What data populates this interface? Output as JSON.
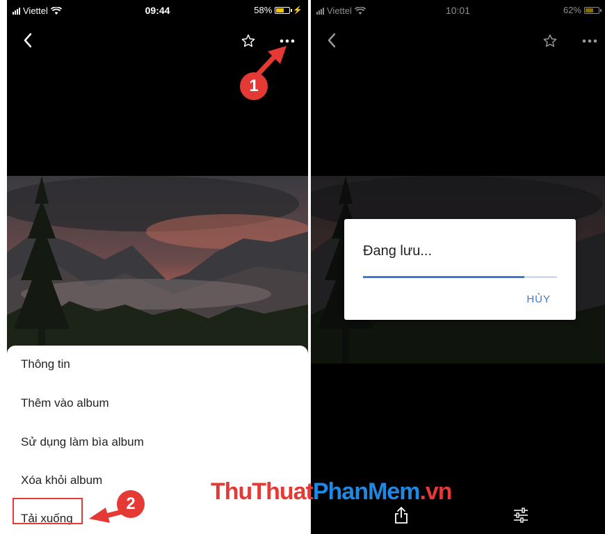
{
  "left_screen": {
    "status": {
      "carrier": "Viettel",
      "time": "09:44",
      "battery": "58%",
      "battery_level": 0.58
    },
    "toolbar": {
      "back_icon": "chevron-left-icon",
      "star_icon": "star-icon",
      "more_icon": "more-horizontal-icon"
    },
    "menu": {
      "items": [
        {
          "label": "Thông tin"
        },
        {
          "label": "Thêm vào album"
        },
        {
          "label": "Sử dụng làm bìa album"
        },
        {
          "label": "Xóa khỏi album"
        },
        {
          "label": "Tải xuống"
        }
      ]
    },
    "steps": [
      "1",
      "2"
    ]
  },
  "right_screen": {
    "status": {
      "carrier": "Viettel",
      "time": "10:01",
      "battery": "62%",
      "battery_level": 0.62
    },
    "dialog": {
      "title": "Đang lưu...",
      "cancel_label": "HỦY",
      "progress": 0.83
    },
    "bottom_bar": {
      "share_icon": "share-icon",
      "adjust_icon": "sliders-icon"
    }
  },
  "watermark": {
    "part1": "ThuThuat",
    "part2": "PhanMem",
    "part3": ".vn"
  },
  "colors": {
    "accent_red": "#e53935",
    "accent_blue": "#3c78d8",
    "battery_yellow": "#f5c400"
  }
}
